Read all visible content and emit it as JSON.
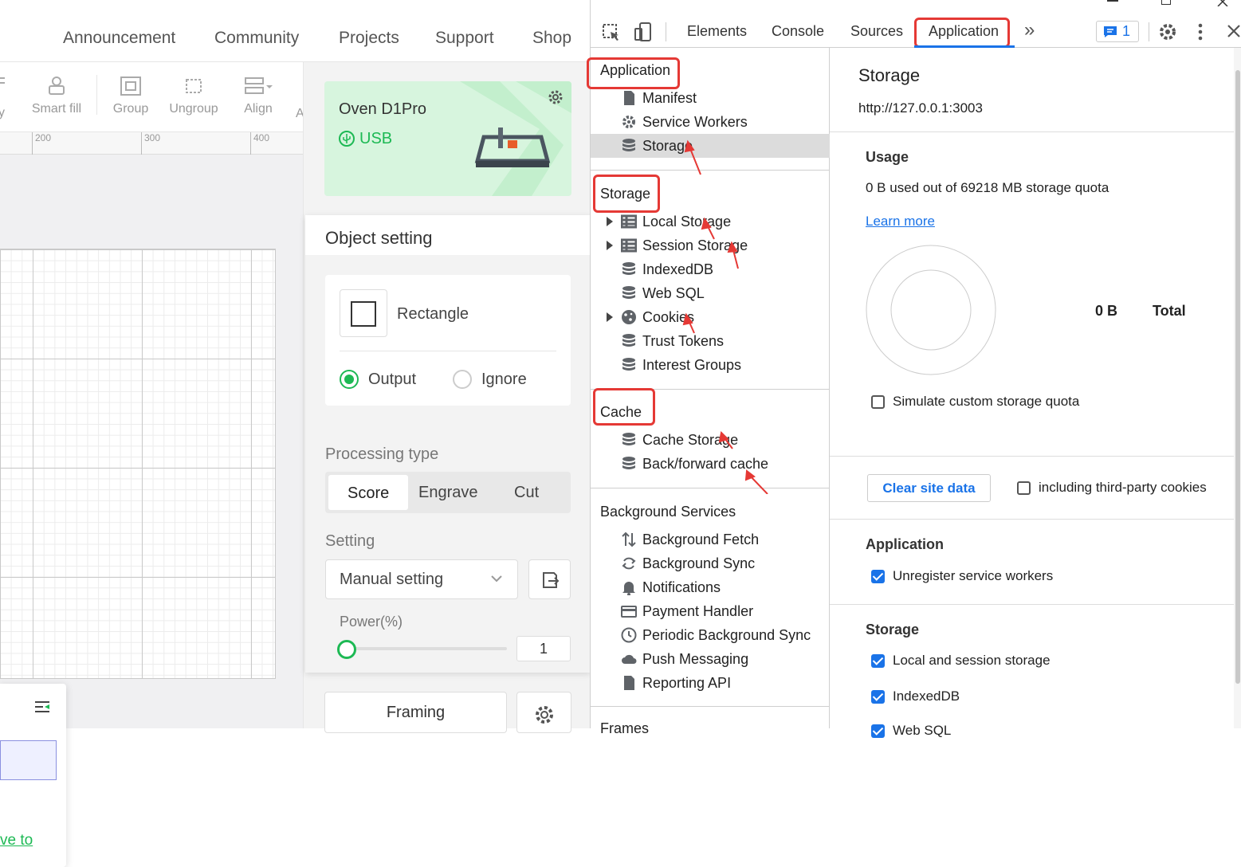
{
  "app": {
    "nav": [
      "Announcement",
      "Community",
      "Projects",
      "Support",
      "Shop"
    ],
    "toolbar": {
      "partial_left": "y",
      "smart_fill": "Smart fill",
      "group": "Group",
      "ungroup": "Ungroup",
      "align": "Align",
      "partial_right": "A"
    },
    "ruler": [
      "200",
      "300",
      "400"
    ],
    "layer_link": "ve to",
    "device": {
      "name": "Oven D1Pro",
      "connection": "USB"
    },
    "object_setting": {
      "title": "Object setting",
      "shape": "Rectangle",
      "output": "Output",
      "ignore": "Ignore",
      "processing_label": "Processing type",
      "processing_types": [
        "Score",
        "Engrave",
        "Cut"
      ],
      "processing_selected": "Score",
      "setting_label": "Setting",
      "setting_value": "Manual setting",
      "power_label": "Power(%)",
      "power_value": "1"
    },
    "framing": "Framing"
  },
  "devtools": {
    "tabs": [
      "Elements",
      "Console",
      "Sources",
      "Application"
    ],
    "active_tab": "Application",
    "more": "»",
    "issues_count": "1",
    "sidebar": {
      "application_head": "Application",
      "application_items": [
        "Manifest",
        "Service Workers",
        "Storage"
      ],
      "storage_head": "Storage",
      "storage_items": [
        "Local Storage",
        "Session Storage",
        "IndexedDB",
        "Web SQL",
        "Cookies",
        "Trust Tokens",
        "Interest Groups"
      ],
      "cache_head": "Cache",
      "cache_items": [
        "Cache Storage",
        "Back/forward cache"
      ],
      "bg_head": "Background Services",
      "bg_items": [
        "Background Fetch",
        "Background Sync",
        "Notifications",
        "Payment Handler",
        "Periodic Background Sync",
        "Push Messaging",
        "Reporting API"
      ],
      "frames_head": "Frames"
    },
    "main": {
      "title": "Storage",
      "origin": "http://127.0.0.1:3003",
      "usage_head": "Usage",
      "usage_text": "0 B used out of 69218 MB storage quota",
      "learn_more": "Learn more",
      "total_value": "0 B",
      "total_label": "Total",
      "simulate": "Simulate custom storage quota",
      "clear_btn": "Clear site data",
      "third_party": "including third-party cookies",
      "app_head": "Application",
      "unregister": "Unregister service workers",
      "storage_head": "Storage",
      "local_session": "Local and session storage",
      "indexeddb": "IndexedDB",
      "websql": "Web SQL"
    }
  },
  "colors": {
    "accent_green": "#1db954",
    "devtools_blue": "#1a73e8",
    "annotation_red": "#e53935",
    "device_bg": "#d7f5de"
  }
}
